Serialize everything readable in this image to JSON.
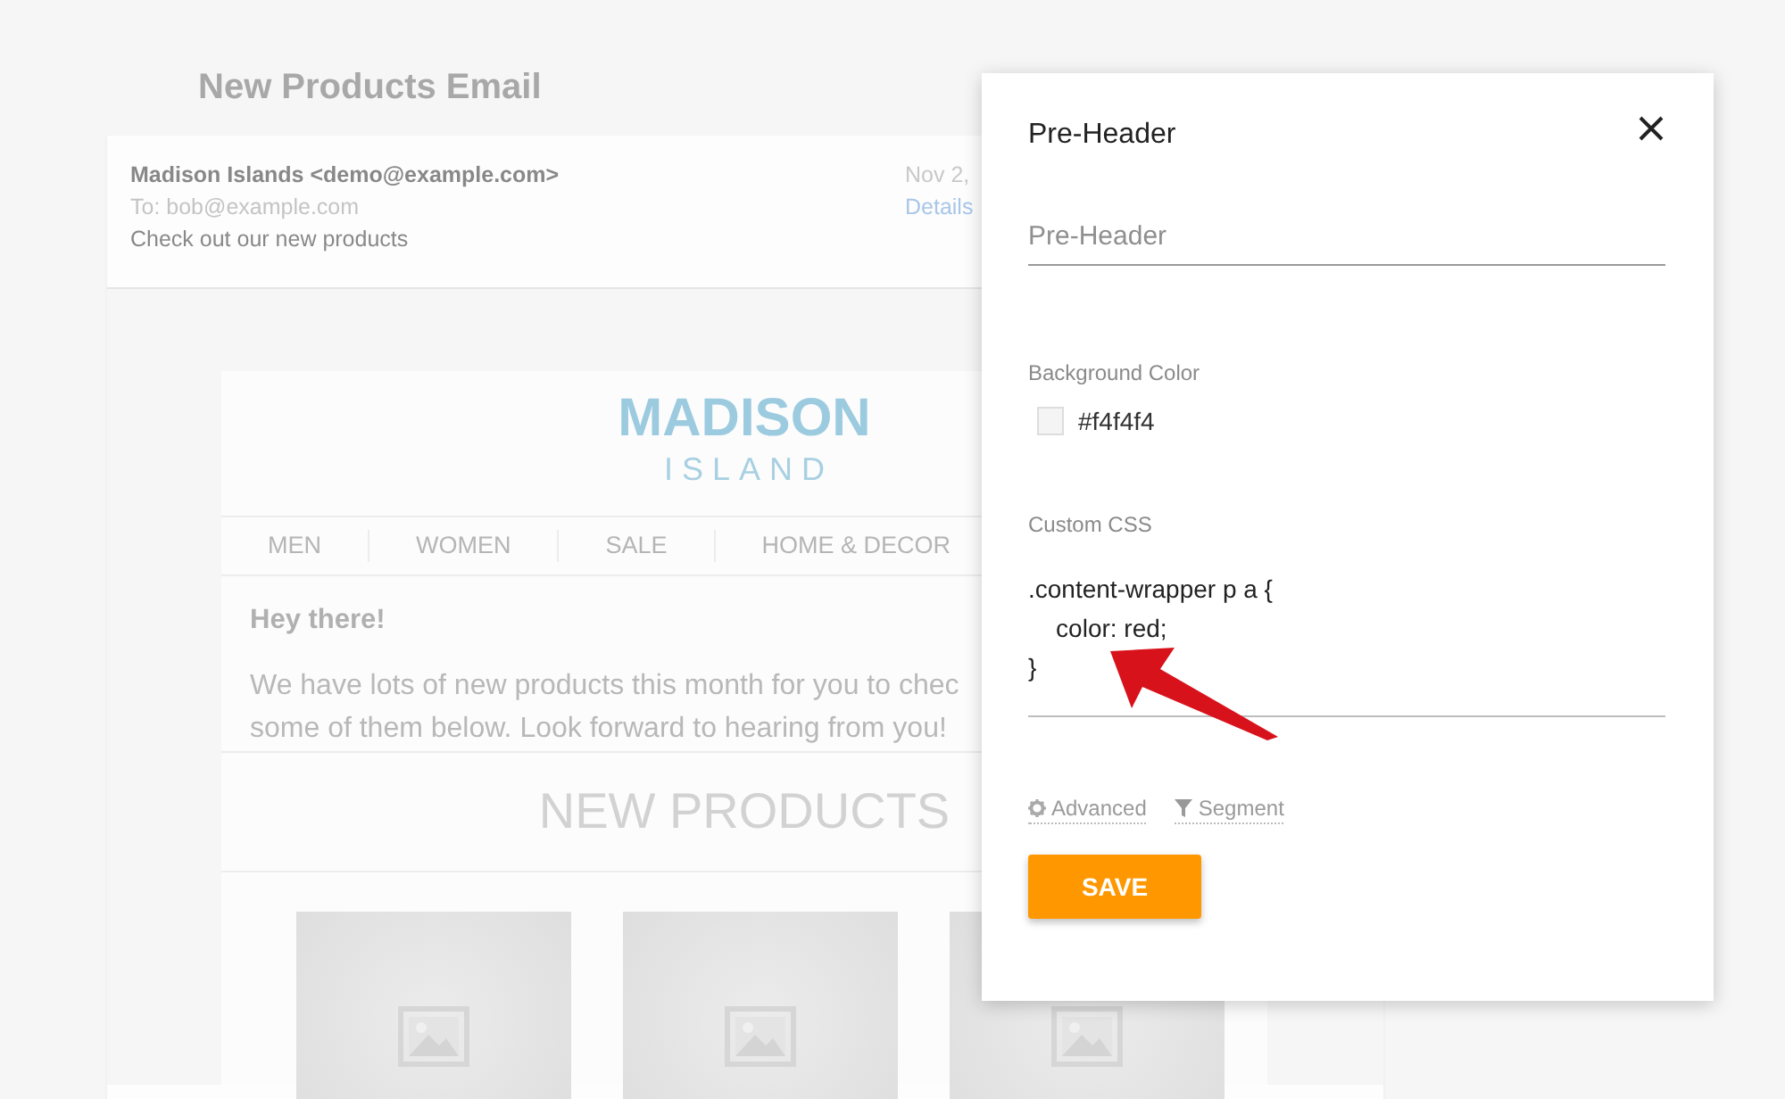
{
  "page": {
    "title": "New Products Email"
  },
  "email": {
    "sender": "Madison Islands <demo@example.com>",
    "to": "To: bob@example.com",
    "subject": "Check out our new products",
    "date": "Nov 2,",
    "details_link": "Details",
    "logo": {
      "name": "MADISON",
      "tagline": "ISLAND"
    },
    "nav": [
      "MEN",
      "WOMEN",
      "SALE",
      "HOME & DECOR"
    ],
    "greeting": "Hey there!",
    "body_lines": [
      "We have lots of new products this month for you to chec",
      "some of them below. Look forward to hearing from you!"
    ],
    "section_heading": "NEW PRODUCTS",
    "products": [
      {
        "kind": "placeholder"
      },
      {
        "kind": "placeholder"
      },
      {
        "kind": "placeholder"
      }
    ]
  },
  "dialog": {
    "title": "Pre-Header",
    "fields": [
      {
        "kind": "text",
        "placeholder": "Pre-Header"
      },
      {
        "kind": "color",
        "label": "Background Color",
        "value": "#f4f4f4",
        "color": "#f4f4f4"
      },
      {
        "kind": "code",
        "label": "Custom CSS",
        "lines": [
          ".content-wrapper p a {",
          "    color: red;",
          "}"
        ]
      }
    ],
    "links": [
      {
        "kind": "gear",
        "label": "Advanced"
      },
      {
        "kind": "filter",
        "label": "Segment"
      }
    ],
    "button": "SAVE"
  }
}
